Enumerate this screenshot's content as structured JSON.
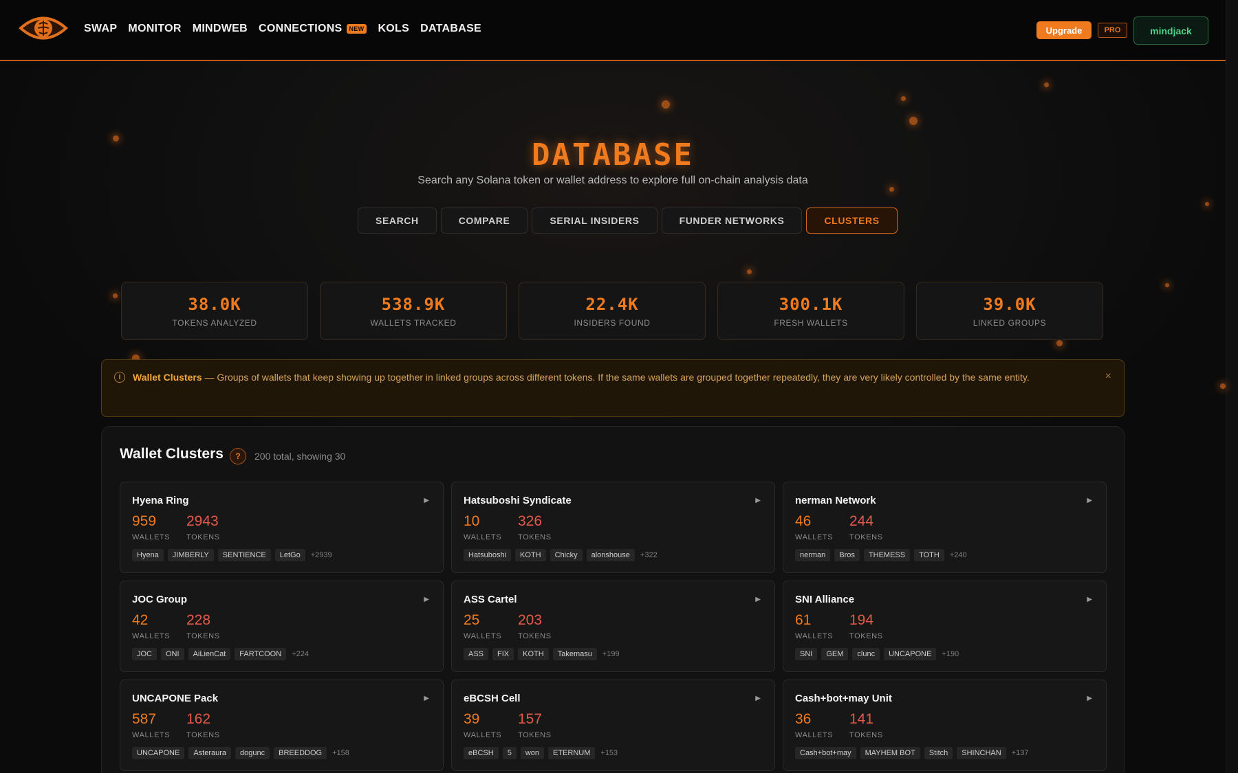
{
  "header": {
    "nav": [
      {
        "label": "SWAP"
      },
      {
        "label": "MONITOR"
      },
      {
        "label": "MINDWEB"
      },
      {
        "label": "CONNECTIONS",
        "badge": "NEW"
      },
      {
        "label": "KOLS"
      },
      {
        "label": "DATABASE"
      }
    ],
    "upgrade_label": "Upgrade",
    "pro_label": "PRO",
    "user_label": "mindjack"
  },
  "hero": {
    "title": "DATABASE",
    "subtitle": "Search any Solana token or wallet address to explore full on-chain analysis data"
  },
  "tabs": [
    {
      "label": "SEARCH",
      "active": false
    },
    {
      "label": "COMPARE",
      "active": false
    },
    {
      "label": "SERIAL INSIDERS",
      "active": false
    },
    {
      "label": "FUNDER NETWORKS",
      "active": false
    },
    {
      "label": "CLUSTERS",
      "active": true
    }
  ],
  "stats": [
    {
      "value": "38.0K",
      "label": "TOKENS ANALYZED"
    },
    {
      "value": "538.9K",
      "label": "WALLETS TRACKED"
    },
    {
      "value": "22.4K",
      "label": "INSIDERS FOUND"
    },
    {
      "value": "300.1K",
      "label": "FRESH WALLETS"
    },
    {
      "value": "39.0K",
      "label": "LINKED GROUPS"
    }
  ],
  "info": {
    "icon": "info-icon",
    "title": "Wallet Clusters",
    "text": " — Groups of wallets that keep showing up together in linked groups across different tokens. If the same wallets are grouped together repeatedly, they are very likely controlled by the same entity.",
    "close": "×"
  },
  "clusters": {
    "title": "Wallet Clusters",
    "help": "?",
    "meta": "200 total, showing 30",
    "wallets_label": "WALLETS",
    "tokens_label": "TOKENS",
    "items": [
      {
        "name": "Hyena Ring",
        "wallets": "959",
        "tokens": "2943",
        "tags": [
          "Hyena",
          "JIMBERLY",
          "SENTIENCE",
          "LetGo"
        ],
        "more": "+2939"
      },
      {
        "name": "Hatsuboshi Syndicate",
        "wallets": "10",
        "tokens": "326",
        "tags": [
          "Hatsuboshi",
          "KOTH",
          "Chicky",
          "alonshouse"
        ],
        "more": "+322"
      },
      {
        "name": "nerman Network",
        "wallets": "46",
        "tokens": "244",
        "tags": [
          "nerman",
          "Bros",
          "THEMESS",
          "TOTH"
        ],
        "more": "+240"
      },
      {
        "name": "JOC Group",
        "wallets": "42",
        "tokens": "228",
        "tags": [
          "JOC",
          "ONI",
          "AiLienCat",
          "FARTCOON"
        ],
        "more": "+224"
      },
      {
        "name": "ASS Cartel",
        "wallets": "25",
        "tokens": "203",
        "tags": [
          "ASS",
          "FIX",
          "KOTH",
          "Takemasu"
        ],
        "more": "+199"
      },
      {
        "name": "SNI Alliance",
        "wallets": "61",
        "tokens": "194",
        "tags": [
          "SNI",
          "GEM",
          "clunc",
          "UNCAPONE"
        ],
        "more": "+190"
      },
      {
        "name": "UNCAPONE Pack",
        "wallets": "587",
        "tokens": "162",
        "tags": [
          "UNCAPONE",
          "Asteraura",
          "dogunc",
          "BREEDDOG"
        ],
        "more": "+158"
      },
      {
        "name": "eBCSH Cell",
        "wallets": "39",
        "tokens": "157",
        "tags": [
          "eBCSH",
          "5",
          "won",
          "ETERNUM"
        ],
        "more": "+153"
      },
      {
        "name": "Cash+bot+may Unit",
        "wallets": "36",
        "tokens": "141",
        "tags": [
          "Cash+bot+may",
          "MAYHEM BOT",
          "Stitch",
          "SHINCHAN"
        ],
        "more": "+137"
      }
    ]
  }
}
